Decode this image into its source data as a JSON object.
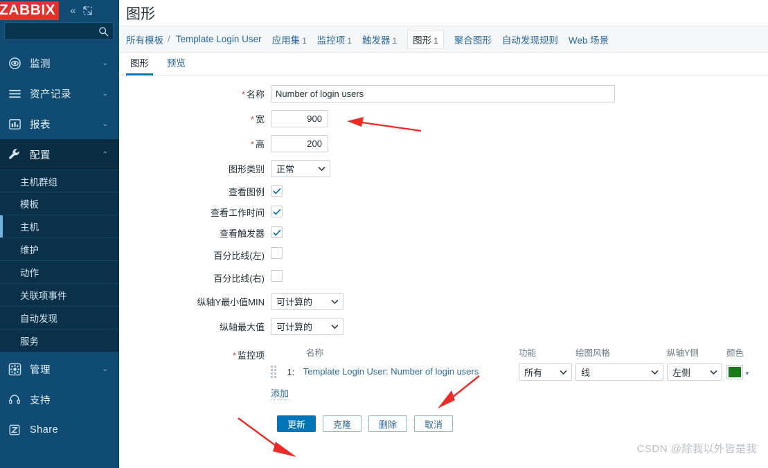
{
  "sidebar": {
    "logo": "ZABBIX",
    "collapse_icon": "chevrons-left-icon",
    "expand_icon": "expand-icon",
    "search": {
      "value": "",
      "placeholder": ""
    },
    "nav": [
      {
        "label": "监测",
        "icon": "eye-icon",
        "caret": "chevron-down-icon",
        "active": false
      },
      {
        "label": "资产记录",
        "icon": "list-icon",
        "caret": "chevron-down-icon",
        "active": false
      },
      {
        "label": "报表",
        "icon": "bar-chart-icon",
        "caret": "chevron-down-icon",
        "active": false
      },
      {
        "label": "配置",
        "icon": "wrench-icon",
        "caret": "chevron-up-icon",
        "active": true
      }
    ],
    "sub_items": [
      {
        "label": "主机群组",
        "active": false
      },
      {
        "label": "模板",
        "active": false
      },
      {
        "label": "主机",
        "active": true
      },
      {
        "label": "维护",
        "active": false
      },
      {
        "label": "动作",
        "active": false
      },
      {
        "label": "关联项事件",
        "active": false
      },
      {
        "label": "自动发现",
        "active": false
      },
      {
        "label": "服务",
        "active": false
      }
    ],
    "foot": [
      {
        "label": "管理",
        "icon": "gear-icon",
        "caret": "chevron-down-icon"
      },
      {
        "label": "支持",
        "icon": "headset-icon",
        "caret": ""
      },
      {
        "label": "Share",
        "icon": "zabbix-z-icon",
        "caret": ""
      }
    ]
  },
  "header": {
    "title": "图形"
  },
  "breadcrumb": [
    {
      "label": "所有模板",
      "count": "",
      "boxed": false,
      "sep": false
    },
    {
      "label": "/",
      "count": "",
      "boxed": false,
      "sep": true
    },
    {
      "label": "Template Login User",
      "count": "",
      "boxed": false,
      "sep": false
    },
    {
      "label": "应用集",
      "count": "1",
      "boxed": false,
      "sep": false
    },
    {
      "label": "监控项",
      "count": "1",
      "boxed": false,
      "sep": false
    },
    {
      "label": "触发器",
      "count": "1",
      "boxed": false,
      "sep": false
    },
    {
      "label": "图形",
      "count": "1",
      "boxed": true,
      "sep": false
    },
    {
      "label": "聚合图形",
      "count": "",
      "boxed": false,
      "sep": false
    },
    {
      "label": "自动发现规则",
      "count": "",
      "boxed": false,
      "sep": false
    },
    {
      "label": "Web 场景",
      "count": "",
      "boxed": false,
      "sep": false
    }
  ],
  "tabs": [
    {
      "label": "图形",
      "active": true
    },
    {
      "label": "预览",
      "active": false
    }
  ],
  "form": {
    "name": {
      "label": "名称",
      "required": true,
      "value": "Number of login users"
    },
    "width": {
      "label": "宽",
      "required": true,
      "value": "900"
    },
    "height": {
      "label": "高",
      "required": true,
      "value": "200"
    },
    "graph_type": {
      "label": "图形类别",
      "required": false,
      "value": "正常"
    },
    "show_legend": {
      "label": "查看图例",
      "checked": true
    },
    "show_working_time": {
      "label": "查看工作时间",
      "checked": true
    },
    "show_triggers": {
      "label": "查看触发器",
      "checked": true
    },
    "percentile_left": {
      "label": "百分比线(左)",
      "checked": false
    },
    "percentile_right": {
      "label": "百分比线(右)",
      "checked": false
    },
    "ymin": {
      "label": "纵轴Y最小值MIN",
      "value": "可计算的"
    },
    "ymax": {
      "label": "纵轴最大值",
      "value": "可计算的"
    }
  },
  "items": {
    "label": "监控项",
    "required": true,
    "columns": {
      "name": "名称",
      "function": "功能",
      "draw_style": "绘图风格",
      "yaxis_side": "纵轴Y侧",
      "color": "颜色"
    },
    "rows": [
      {
        "index": "1:",
        "name": "Template Login User: Number of login users",
        "function": "所有",
        "draw_style": "线",
        "yaxis_side": "左侧",
        "color": "#1a7a1a"
      }
    ],
    "add_label": "添加"
  },
  "buttons": [
    {
      "label": "更新",
      "kind": "primary"
    },
    {
      "label": "克隆",
      "kind": "secondary"
    },
    {
      "label": "删除",
      "kind": "secondary"
    },
    {
      "label": "取消",
      "kind": "secondary"
    }
  ],
  "watermark": "CSDN @除我以外皆是我",
  "colors": {
    "sidebar_bg": "#0f4b72",
    "sidebar_active": "#0a2d44",
    "logo_red": "#e8302b",
    "link_blue": "#2e6a9e",
    "primary_blue": "#0275b8",
    "required_red": "#d64646",
    "annotation_red": "#ee2a24"
  }
}
